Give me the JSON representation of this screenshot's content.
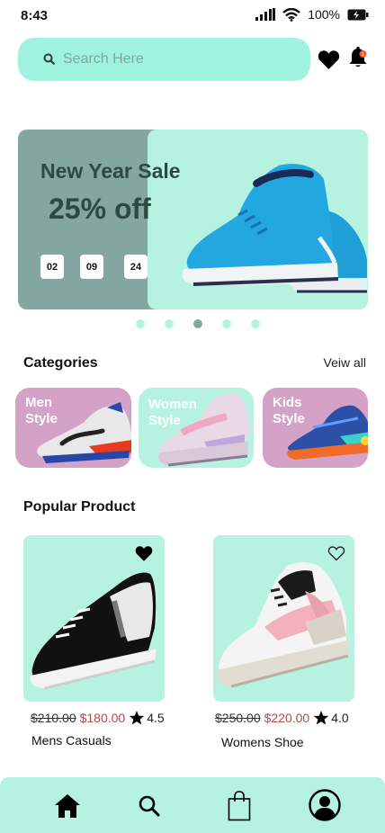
{
  "status_bar": {
    "time": "8:43",
    "battery": "100%"
  },
  "search": {
    "placeholder": "Search Here"
  },
  "banner": {
    "title": "New Year Sale",
    "discount": "25% off",
    "countdown": [
      "02",
      "09",
      "24"
    ]
  },
  "carousel": {
    "dots": 5,
    "active_index": 2
  },
  "categories": {
    "title": "Categories",
    "view_all": "Veiw all",
    "items": [
      {
        "label": "Men Style",
        "bg": "#d4a1c7"
      },
      {
        "label": "Women Style",
        "bg": "#b5f2e0"
      },
      {
        "label": "Kids Style",
        "bg": "#d4a1c7"
      }
    ]
  },
  "popular": {
    "title": "Popular Product",
    "products": [
      {
        "name": "Mens Casuals",
        "old_price": "$210.00",
        "price": "$180.00",
        "rating": "4.5",
        "favorited": true
      },
      {
        "name": "Womens Shoe",
        "old_price": "$250.00",
        "price": "$220.00",
        "rating": "4.0",
        "favorited": false
      }
    ]
  },
  "colors": {
    "mint": "#9ff2de",
    "mint_light": "#b5f2e0",
    "sage": "#83a79e",
    "pink": "#d4a1c7",
    "price_red": "#b34a4a"
  }
}
